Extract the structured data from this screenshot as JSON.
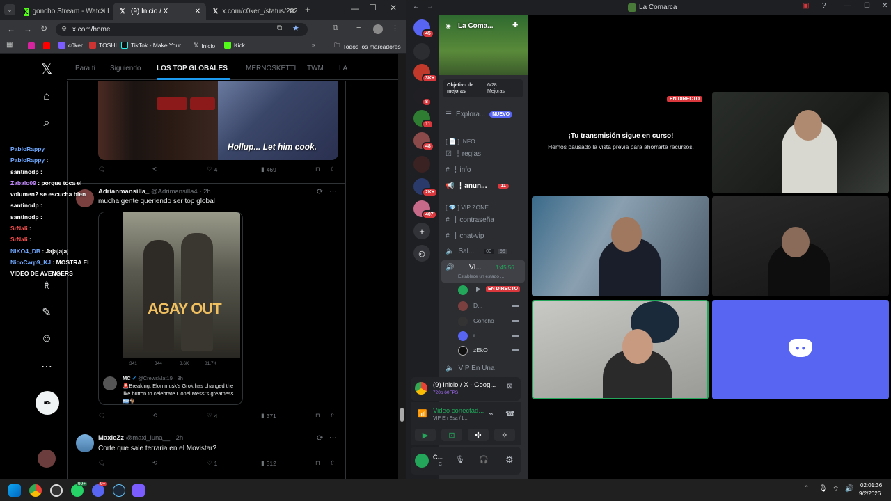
{
  "chrome": {
    "tabs": [
      {
        "label": "goncho Stream - Watch I",
        "icon": "kick-icon"
      },
      {
        "label": "(9) Inicio / X",
        "icon": "x-icon"
      },
      {
        "label": "x.com/c0ker_/status/202",
        "icon": "x-icon"
      }
    ],
    "url": "x.com/home",
    "bookmarks": [
      {
        "label": "c0ker"
      },
      {
        "label": "TOSHI"
      },
      {
        "label": "TikTok - Make Your..."
      },
      {
        "label": "Inicio"
      },
      {
        "label": "Kick"
      }
    ],
    "bookmarks_folder": "Todos los marcadores"
  },
  "x": {
    "tabs": [
      "Para ti",
      "Siguiendo",
      "LOS TOP GLOBALES",
      "MERNOSKETTI",
      "TWM",
      "LA"
    ],
    "post1": {
      "image_caption": "Hollup... Let him cook.",
      "replies": "",
      "retweets": "",
      "likes": "4",
      "views": "469"
    },
    "post2": {
      "name": "Adrianmansilla_",
      "handle": "@Adrimansilla4",
      "time": "· 2h",
      "text": "mucha gente queriendo ser top global",
      "image_text": "AGAY OUT",
      "mini_stats": [
        "341",
        "344",
        "3,6K",
        "81,7K"
      ],
      "quote_name": "MC",
      "quote_handle": "@CrewsMat19 · 3h",
      "quote_text": "🚨Breaking: Elon musk's Grok has changed the like button to celebrate Lionel Messi's greatness 🇦🇷🐐",
      "likes": "4",
      "views": "371"
    },
    "post3": {
      "name": "MaxieZz",
      "handle": "@maxi_luna__",
      "time": "· 2h",
      "text": "Corte que sale terraria en el Movistar?",
      "likes": "1",
      "views": "312"
    }
  },
  "chat": [
    {
      "user": "PabloRappy",
      "msg": "",
      "color": "#6ea8ff"
    },
    {
      "user": "PabloRappy",
      "msg": ":",
      "color": "#6ea8ff"
    },
    {
      "user": "santinodp",
      "msg": ":",
      "color": "#ffffff"
    },
    {
      "user": "Zabalo09",
      "msg": ": porque toca el volumen? se escucha bien",
      "color": "#c58cff"
    },
    {
      "user": "santinodp",
      "msg": ":",
      "color": "#ffffff"
    },
    {
      "user": "santinodp",
      "msg": ":",
      "color": "#ffffff"
    },
    {
      "user": "SrNali",
      "msg": ":",
      "color": "#ff4d4d"
    },
    {
      "user": "SrNali",
      "msg": ":",
      "color": "#ff4d4d"
    },
    {
      "user": "NIKO4_DB",
      "msg": ": Jajajajaj",
      "color": "#6ea8ff"
    },
    {
      "user": "NicoCarp9_KJ",
      "msg": ": MOSTRA EL VIDEO DE AVENGERS",
      "color": "#6ea8ff"
    }
  ],
  "discord": {
    "window_title": "La Comarca",
    "server_name": "La Coma...",
    "boost_label": "Objetivo de mejoras",
    "boost_count": "6/28 Mejoras",
    "explore": "Explora...",
    "explore_badge": "NUEVO",
    "info_category": "[ 📄 ] INFO",
    "vip_category": "[ 💎 ] VIP ZONE",
    "channels": [
      {
        "name": "┆ reglas",
        "type": "text"
      },
      {
        "name": "┆ info",
        "type": "text"
      },
      {
        "name": "┆ anun...",
        "type": "announce",
        "badge": "11"
      },
      {
        "name": "┆ contraseña",
        "type": "text"
      },
      {
        "name": "┆ chat-vip",
        "type": "text"
      },
      {
        "name": "Sal...",
        "type": "voice",
        "counts": [
          "00",
          "99"
        ]
      },
      {
        "name": "VI...",
        "type": "voice-active",
        "timer": "1:45:56",
        "status": "Establece un estado ..."
      },
      {
        "name": "VIP En Una",
        "type": "voice"
      }
    ],
    "voice_users": [
      {
        "name": "",
        "live": "EN DIRECTO"
      },
      {
        "name": "D..."
      },
      {
        "name": "Goncho"
      },
      {
        "name": "r..."
      },
      {
        "name": "zEkO"
      }
    ],
    "server_badges": [
      "45",
      "",
      "3K+",
      "8",
      "11",
      "48",
      "",
      "2K+",
      "407"
    ],
    "stream_card": {
      "title": "(9) Inicio / X - Goog...",
      "sub": "720p 60FPS"
    },
    "voice_connected": "Video conectad...",
    "voice_channel": "VIP En Esa / L...",
    "user_name": "C...",
    "user_status": "C",
    "stage_live": "EN DIRECTO",
    "paused_title": "¡Tu transmisión sigue en curso!",
    "paused_sub": "Hemos pausado la vista previa para ahorrarte recursos."
  },
  "taskbar": {
    "time": "02:01:36",
    "date": "9/2/2026",
    "whatsapp_badge": "99+",
    "discord_badge": "9+"
  }
}
